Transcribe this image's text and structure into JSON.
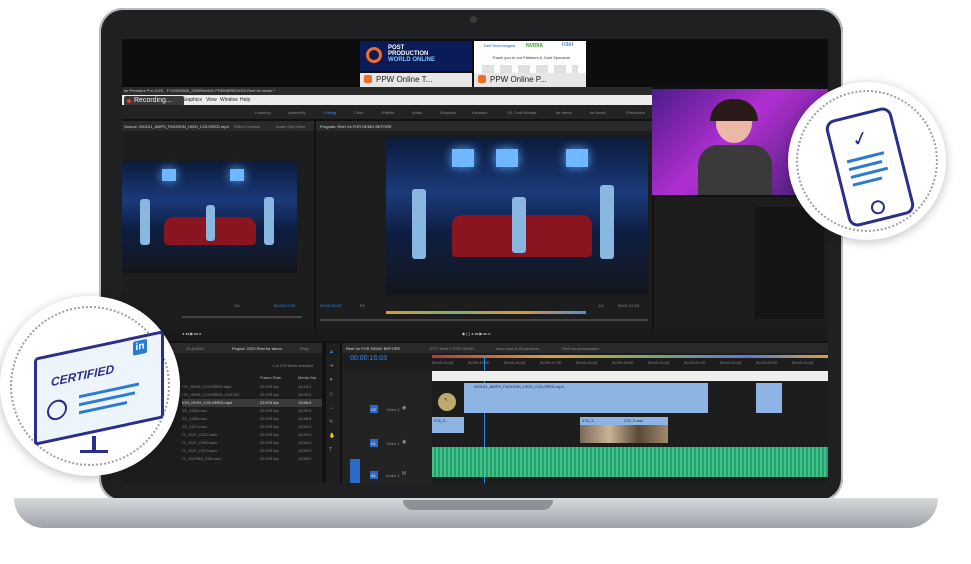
{
  "banner": {
    "logo_line1": "POST",
    "logo_line2": "PRODUCTION",
    "logo_line3": "WORLD ONLINE",
    "sponsors_line": "Thank you to our Platinum & Gold Sponsors",
    "sponsor_1": "Dell Technologies",
    "sponsor_2": "NVIDIA",
    "sponsor_3": "intel",
    "tab_left": "PPW Online T...",
    "tab_right": "PPW Online P..."
  },
  "app": {
    "title": "be Premiere Pro 2020 - F:\\20200820_2020Reel\\01 PREMIERE\\2020 Reel for demo *",
    "recording_label": "Recording...",
    "menu": [
      "Graphics",
      "View",
      "Window",
      "Help"
    ],
    "workspaces": [
      "Learning",
      "Assembly",
      "Editing",
      "Color",
      "Effects",
      "Audio",
      "Graphics",
      "Libraries",
      "EL Cool Monitor",
      "for demo",
      "for Ameil",
      "Production"
    ],
    "active_workspace": "Editing"
  },
  "source_monitor": {
    "tab_source": "Source: 200101_AMPS_FASHION_HIGH_COLORED.mp4",
    "tab_effect": "Effect Controls",
    "tab_audio": "Audio Clip Mixer",
    "zoom": "1/4",
    "timecode": "00:00:07:09"
  },
  "program_monitor": {
    "title": "Program: Reel Vs FOR DEMO BEFORE",
    "timecode_left": "00:00:16:03",
    "fit": "Fit",
    "zoom": "1/4",
    "timecode_right": "00:01:22:23"
  },
  "project": {
    "tab_1": "20 AUDIO",
    "tab_2": "Project: 2020 Reel for demo",
    "tab_3": "Prog",
    "items_selected": "1 of 179 items selected",
    "col_frame_rate": "Frame Rate",
    "col_media_start": "Media Sta",
    "rows": [
      {
        "name": "ITY_HIGH_COLORED.mp4",
        "rate": "23.976 fps",
        "start": "14:24:2"
      },
      {
        "name": "ITY_HIGH_COLORED_OUTDO",
        "rate": "23.976 fps",
        "start": "15:02:0"
      },
      {
        "name": "ION_HIGH_COLORED.mp4",
        "rate": "23.976 fps",
        "start": "13:56:0"
      },
      {
        "name": "ST_1332.mov",
        "rate": "23.976 fps",
        "start": "19:30:0"
      },
      {
        "name": "ST_1326.mov",
        "rate": "23.976 fps",
        "start": "19:46:5"
      },
      {
        "name": "ST_1371.mov",
        "rate": "23.976 fps",
        "start": "19:52:0"
      },
      {
        "name": "IY_1327_C022.mov",
        "rate": "23.976 fps",
        "start": "19:43:0"
      },
      {
        "name": "IY_1327_C050.mov",
        "rate": "23.976 fps",
        "start": "19:54:0"
      },
      {
        "name": "IY_1327_C073.mov",
        "rate": "23.976 fps",
        "start": "19:50:0"
      },
      {
        "name": "IY_1327MA_C06.mov",
        "rate": "23.976 fps",
        "start": "19:55:0"
      }
    ]
  },
  "timeline": {
    "tab_active": "Reel Vs FOR DEMO BEFORE",
    "tab_2": "ETS Tilmit 2 FOR DEMO",
    "tab_3": "auto color to fit premiere",
    "tab_4": "Reel for presentation",
    "timecode": "00:00:16:03",
    "ruler": [
      "00:00:14:00",
      "00:00:15:00",
      "00:00:16:00",
      "00:00:17:00",
      "00:00:18:00",
      "00:00:19:00",
      "00:00:20:00",
      "00:00:21:00",
      "00:00:22:00",
      "00:00:23:00",
      "00:00:24:00"
    ],
    "track_v2": "V2",
    "track_v1": "V1",
    "track_a1": "A1",
    "label_video2": "Video 2",
    "label_video1": "Video 1",
    "label_audio1": "Audio 1",
    "clip_main": "200101_AMPS_FASHION_HIGH_COLORED.mp4",
    "clip_a": "076_0..",
    "clip_b": "376_3..",
    "clip_c": "376_3 aaa"
  },
  "badges": {
    "certified": "CERTIFIED",
    "linkedin": "in"
  },
  "colors": {
    "accent_blue": "#2d8ceb",
    "clip_blue": "#8db4e2",
    "clip_green": "#3cc48b",
    "icon_navy": "#2b2e8a"
  }
}
